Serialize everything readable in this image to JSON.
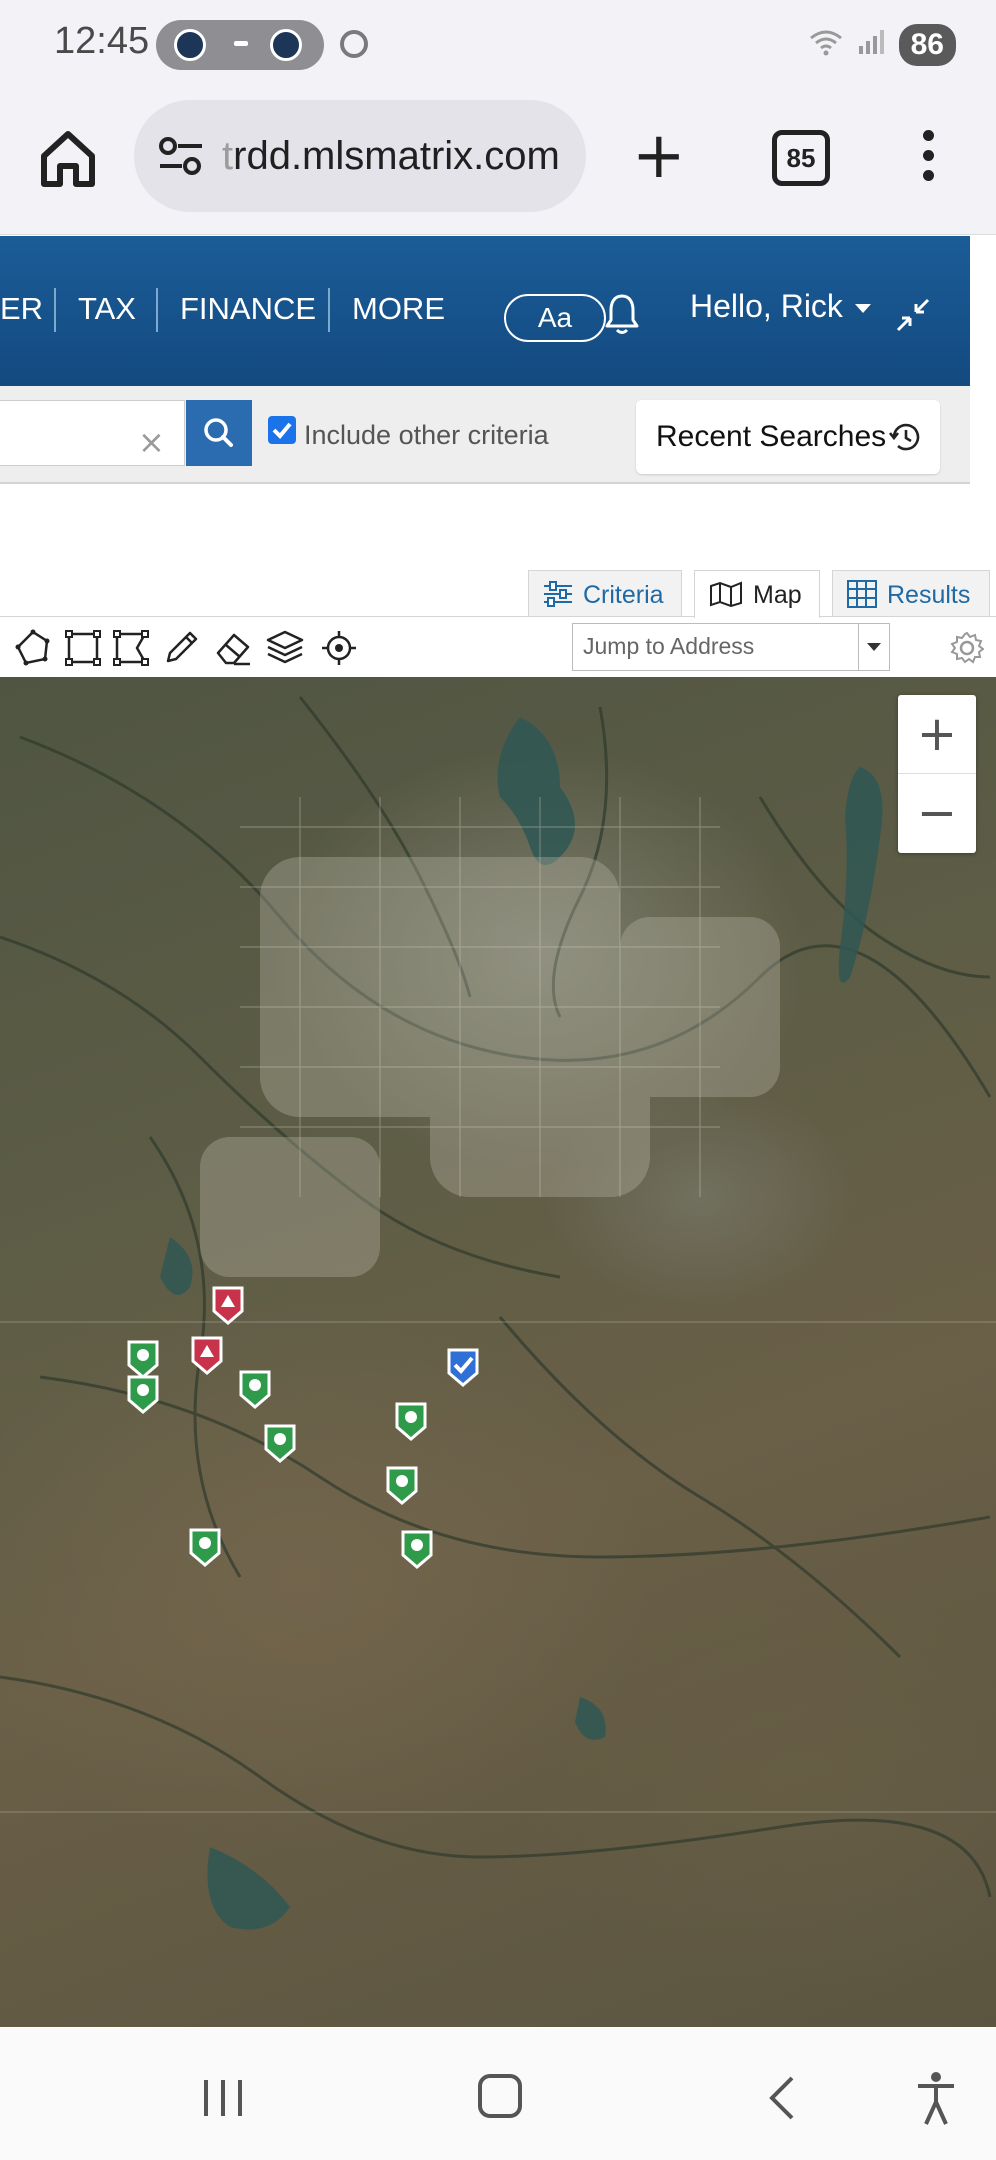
{
  "status_bar": {
    "time": "12:45",
    "battery": "86",
    "wifi_icon": "wifi-icon",
    "signal_icon": "signal-icon"
  },
  "browser": {
    "url_prefix": "t",
    "url": "rdd.mlsmatrix.com",
    "tab_count": "85"
  },
  "nav": {
    "items": [
      "ER",
      "TAX",
      "FINANCE",
      "MORE"
    ],
    "font_button": "Aa",
    "greeting": "Hello, Rick"
  },
  "search": {
    "clear_symbol": "×",
    "include_other_criteria_label": "Include other criteria",
    "include_other_criteria_checked": true,
    "recent_searches_label": "Recent Searches"
  },
  "view_tabs": {
    "criteria": "Criteria",
    "map": "Map",
    "results": "Results",
    "active": "Map"
  },
  "map_toolbar": {
    "jump_placeholder": "Jump to Address"
  },
  "map": {
    "zoom_in": "+",
    "zoom_out": "−",
    "marker_colors": {
      "active": "#2e9a4a",
      "new": "#c8324a",
      "selected": "#2f6fd6"
    }
  }
}
